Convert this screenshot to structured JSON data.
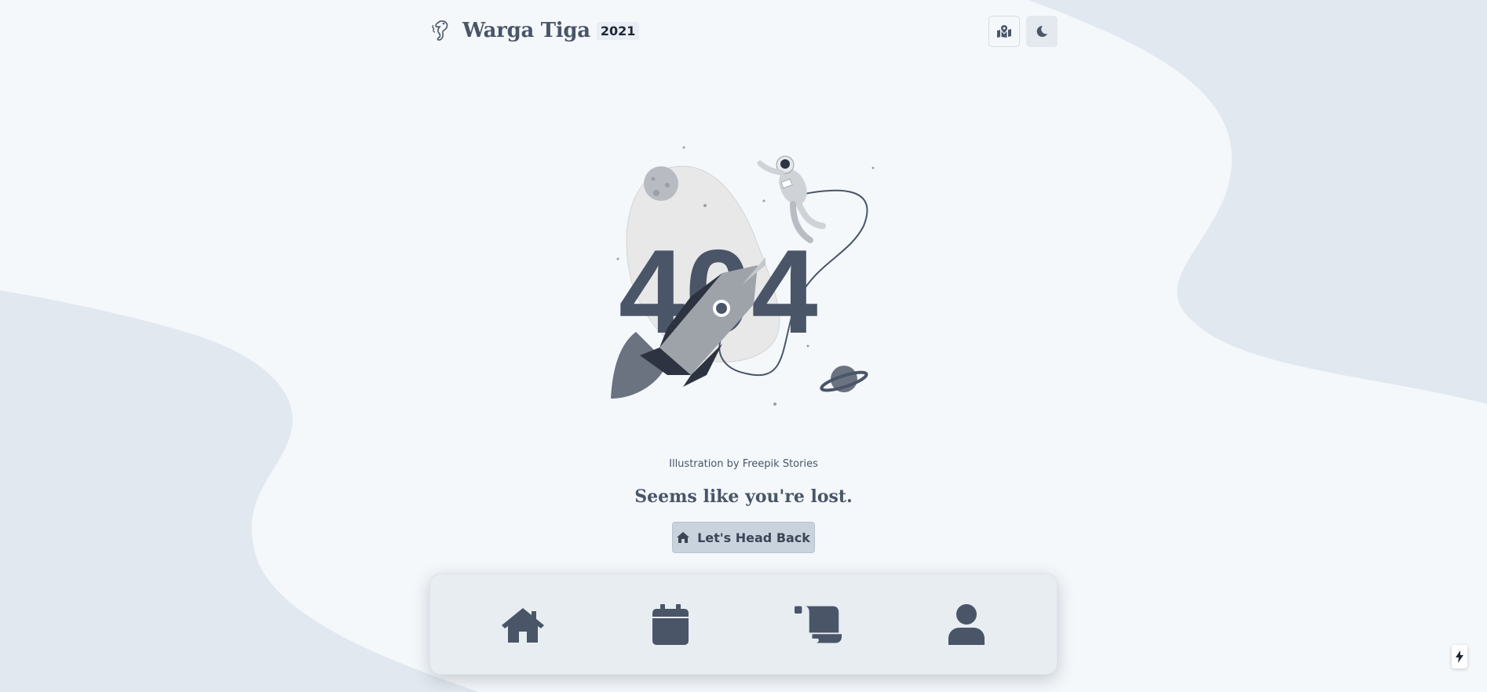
{
  "header": {
    "brand_icon": "seahorse-logo-icon",
    "title": "Warga Tiga",
    "year_badge": "2021",
    "map_button_icon": "map-marked-icon",
    "theme_button_icon": "moon-icon"
  },
  "error_page": {
    "illustration_text": "404",
    "illustration_icon": "astronaut-rocket-404-illustration",
    "credit": "Illustration by Freepik Stories",
    "message": "Seems like you're lost.",
    "button_label": "Let's Head Back",
    "button_icon": "home-icon"
  },
  "bottom_nav": {
    "items": [
      {
        "icon": "home-icon"
      },
      {
        "icon": "calendar-icon"
      },
      {
        "icon": "scroll-icon"
      },
      {
        "icon": "user-icon"
      }
    ]
  },
  "corner_button_icon": "bolt-icon",
  "colors": {
    "background": "#f4f8fb",
    "wave": "#e2e8f0",
    "text": "#4a5568",
    "button": "#c8d3de",
    "nav_background": "#e8edf2"
  }
}
